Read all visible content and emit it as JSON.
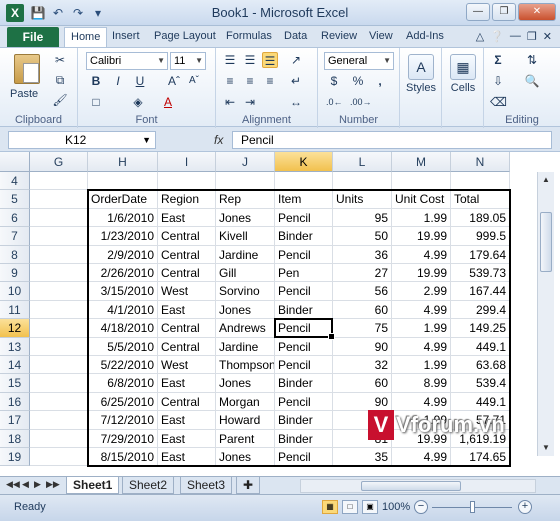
{
  "window": {
    "title": "Book1 - Microsoft Excel",
    "app_icon": "X"
  },
  "quick_access": {
    "save_icon": "save-icon",
    "undo_icon": "undo-icon",
    "redo_icon": "redo-icon"
  },
  "tabs": [
    "File",
    "Home",
    "Insert",
    "Page Layout",
    "Formulas",
    "Data",
    "Review",
    "View",
    "Add-Ins"
  ],
  "active_tab": "Home",
  "ribbon": {
    "clipboard": {
      "label": "Clipboard",
      "paste": "Paste"
    },
    "font": {
      "label": "Font",
      "name": "Calibri",
      "size": "11",
      "bold": "B",
      "italic": "I",
      "underline": "U"
    },
    "alignment": {
      "label": "Alignment"
    },
    "number": {
      "label": "Number",
      "format": "General",
      "currency": "$",
      "percent": "%",
      "comma": ","
    },
    "styles": {
      "label": "Styles"
    },
    "cells": {
      "label": "Cells"
    },
    "editing": {
      "label": "Editing"
    }
  },
  "formula_bar": {
    "name_box": "K12",
    "fx": "fx",
    "formula": "Pencil"
  },
  "columns": [
    "G",
    "H",
    "I",
    "J",
    "K",
    "L",
    "M",
    "N"
  ],
  "selected_column": "K",
  "rows": [
    "4",
    "5",
    "6",
    "7",
    "8",
    "9",
    "10",
    "11",
    "12",
    "13",
    "14",
    "15",
    "16",
    "17",
    "18",
    "19"
  ],
  "selected_row": "12",
  "table": {
    "headers": [
      "OrderDate",
      "Region",
      "Rep",
      "Item",
      "Units",
      "Unit Cost",
      "Total"
    ],
    "data": [
      [
        "1/6/2010",
        "East",
        "Jones",
        "Pencil",
        "95",
        "1.99",
        "189.05"
      ],
      [
        "1/23/2010",
        "Central",
        "Kivell",
        "Binder",
        "50",
        "19.99",
        "999.5"
      ],
      [
        "2/9/2010",
        "Central",
        "Jardine",
        "Pencil",
        "36",
        "4.99",
        "179.64"
      ],
      [
        "2/26/2010",
        "Central",
        "Gill",
        "Pen",
        "27",
        "19.99",
        "539.73"
      ],
      [
        "3/15/2010",
        "West",
        "Sorvino",
        "Pencil",
        "56",
        "2.99",
        "167.44"
      ],
      [
        "4/1/2010",
        "East",
        "Jones",
        "Binder",
        "60",
        "4.99",
        "299.4"
      ],
      [
        "4/18/2010",
        "Central",
        "Andrews",
        "Pencil",
        "75",
        "1.99",
        "149.25"
      ],
      [
        "5/5/2010",
        "Central",
        "Jardine",
        "Pencil",
        "90",
        "4.99",
        "449.1"
      ],
      [
        "5/22/2010",
        "West",
        "Thompson",
        "Pencil",
        "32",
        "1.99",
        "63.68"
      ],
      [
        "6/8/2010",
        "East",
        "Jones",
        "Binder",
        "60",
        "8.99",
        "539.4"
      ],
      [
        "6/25/2010",
        "Central",
        "Morgan",
        "Pencil",
        "90",
        "4.99",
        "449.1"
      ],
      [
        "7/12/2010",
        "East",
        "Howard",
        "Binder",
        "29",
        "1.99",
        "57.71"
      ],
      [
        "7/29/2010",
        "East",
        "Parent",
        "Binder",
        "81",
        "19.99",
        "1,619.19"
      ],
      [
        "8/15/2010",
        "East",
        "Jones",
        "Pencil",
        "35",
        "4.99",
        "174.65"
      ]
    ]
  },
  "sheets": [
    "Sheet1",
    "Sheet2",
    "Sheet3"
  ],
  "active_sheet": "Sheet1",
  "status": {
    "text": "Ready",
    "zoom": "100%"
  },
  "watermark": {
    "letter": "V",
    "text": "Vforum.vn"
  }
}
